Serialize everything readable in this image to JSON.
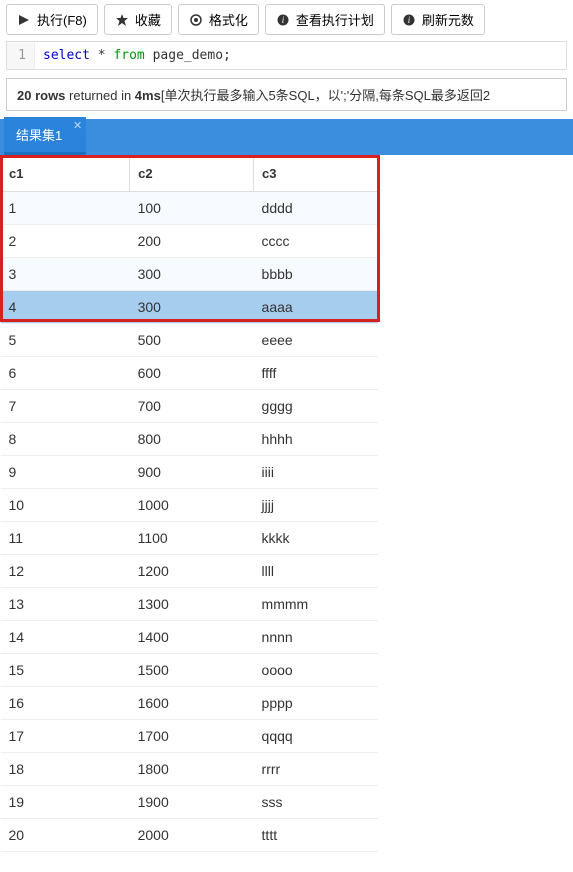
{
  "toolbar": {
    "execute": "执行(F8)",
    "favorite": "收藏",
    "format": "格式化",
    "explain": "查看执行计划",
    "refresh": "刷新元数"
  },
  "editor": {
    "line_no": "1",
    "sql_select": "select",
    "sql_star": " * ",
    "sql_from": "from",
    "sql_rest": " page_demo;"
  },
  "status": {
    "rows_count": "20 rows",
    "returned_in": " returned in ",
    "time": "4ms",
    "note": "[单次执行最多输入5条SQL，以';'分隔,每条SQL最多返回2"
  },
  "tabs": {
    "result_tab": "结果集1"
  },
  "table": {
    "headers": [
      "c1",
      "c2",
      "c3"
    ],
    "rows": [
      {
        "c1": "1",
        "c2": "100",
        "c3": "dddd",
        "alt": true
      },
      {
        "c1": "2",
        "c2": "200",
        "c3": "cccc"
      },
      {
        "c1": "3",
        "c2": "300",
        "c3": "bbbb",
        "alt": true
      },
      {
        "c1": "4",
        "c2": "300",
        "c3": "aaaa",
        "sel": true
      },
      {
        "c1": "5",
        "c2": "500",
        "c3": "eeee"
      },
      {
        "c1": "6",
        "c2": "600",
        "c3": "ffff"
      },
      {
        "c1": "7",
        "c2": "700",
        "c3": "gggg"
      },
      {
        "c1": "8",
        "c2": "800",
        "c3": "hhhh"
      },
      {
        "c1": "9",
        "c2": "900",
        "c3": "iiii"
      },
      {
        "c1": "10",
        "c2": "1000",
        "c3": "jjjj"
      },
      {
        "c1": "11",
        "c2": "1100",
        "c3": "kkkk"
      },
      {
        "c1": "12",
        "c2": "1200",
        "c3": "llll"
      },
      {
        "c1": "13",
        "c2": "1300",
        "c3": "mmmm"
      },
      {
        "c1": "14",
        "c2": "1400",
        "c3": "nnnn"
      },
      {
        "c1": "15",
        "c2": "1500",
        "c3": "oooo"
      },
      {
        "c1": "16",
        "c2": "1600",
        "c3": "pppp"
      },
      {
        "c1": "17",
        "c2": "1700",
        "c3": "qqqq"
      },
      {
        "c1": "18",
        "c2": "1800",
        "c3": "rrrr"
      },
      {
        "c1": "19",
        "c2": "1900",
        "c3": "sss"
      },
      {
        "c1": "20",
        "c2": "2000",
        "c3": "tttt"
      }
    ]
  }
}
